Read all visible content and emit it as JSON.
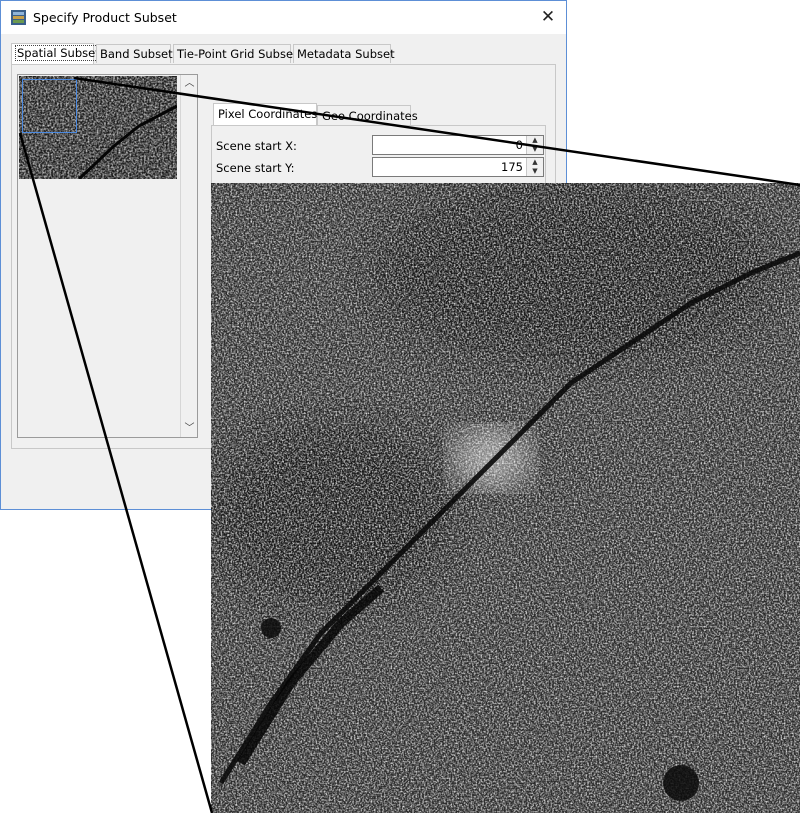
{
  "dialog": {
    "title": "Specify Product Subset",
    "close_icon": "close-icon",
    "app_icon": "product-subset-icon"
  },
  "tabs": [
    {
      "label": "Spatial Subset",
      "active": true
    },
    {
      "label": "Band Subset",
      "active": false
    },
    {
      "label": "Tie-Point Grid Subset",
      "active": false
    },
    {
      "label": "Metadata Subset",
      "active": false
    }
  ],
  "coord_tabs": [
    {
      "label": "Pixel Coordinates",
      "active": true
    },
    {
      "label": "Geo Coordinates",
      "active": false
    }
  ],
  "fields": {
    "scene_start_x": {
      "label": "Scene start X:",
      "value": "0"
    },
    "scene_start_y": {
      "label": "Scene start Y:",
      "value": "175"
    }
  },
  "thumbnail": {
    "scroll_up_icon": "chevron-up-icon",
    "scroll_down_icon": "chevron-down-icon"
  },
  "colors": {
    "accent": "#4c8ae0",
    "window_border": "#5d8fd6",
    "panel": "#f0f0f0"
  }
}
